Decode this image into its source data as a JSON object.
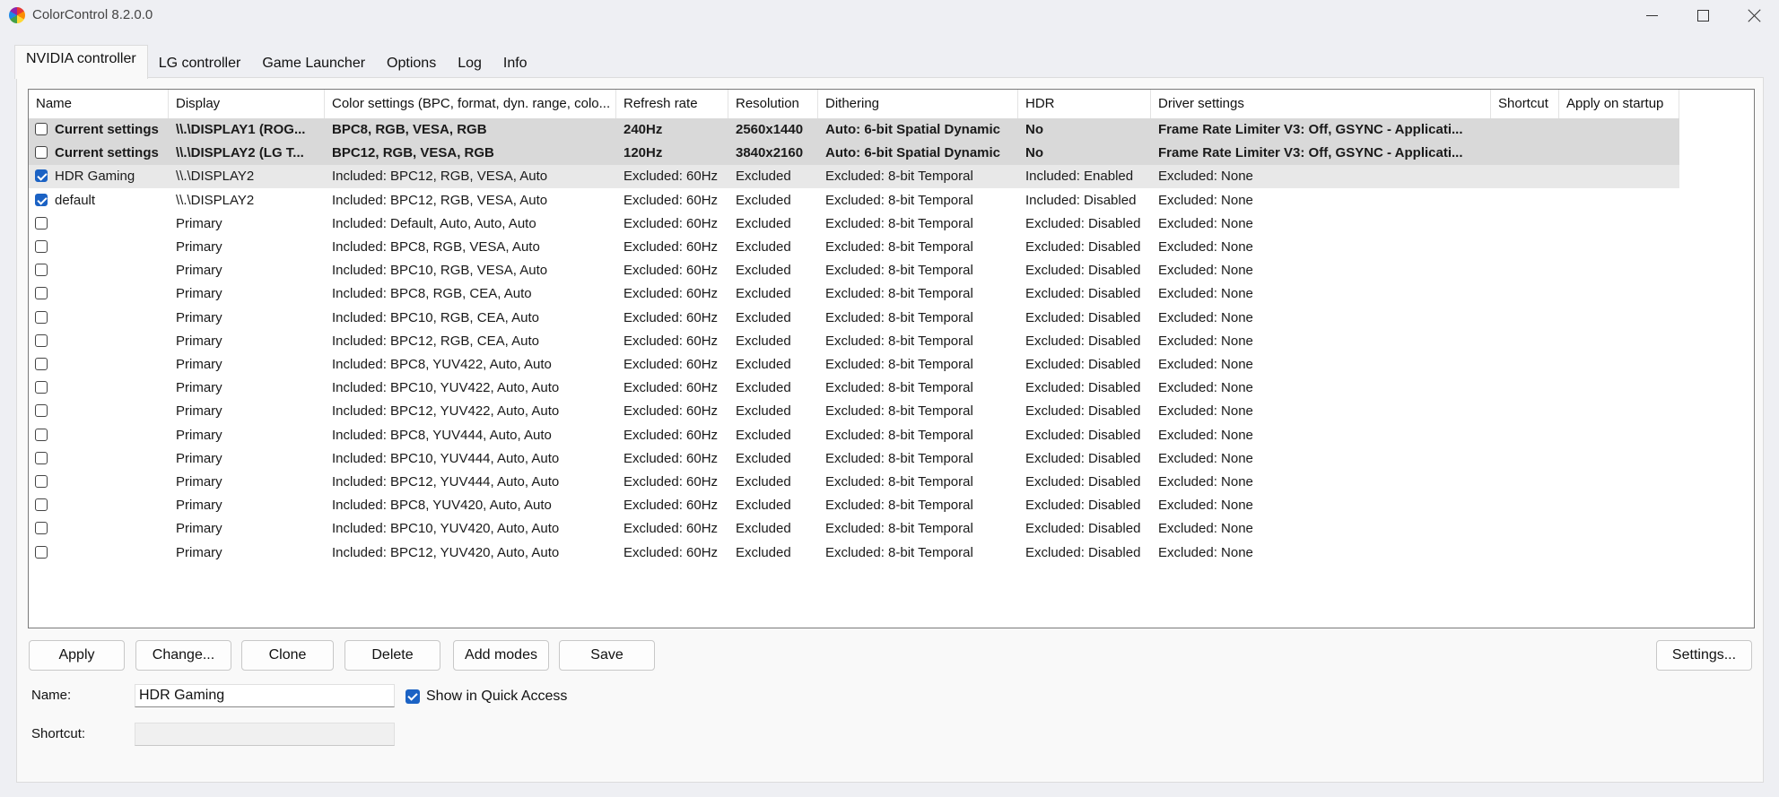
{
  "window": {
    "title": "ColorControl 8.2.0.0"
  },
  "tabs": [
    "NVIDIA controller",
    "LG controller",
    "Game Launcher",
    "Options",
    "Log",
    "Info"
  ],
  "grid": {
    "columns": [
      "Name",
      "Display",
      "Color settings (BPC, format, dyn. range, colo...",
      "Refresh rate",
      "Resolution",
      "Dithering",
      "HDR",
      "Driver settings",
      "Shortcut",
      "Apply on startup"
    ],
    "rows": [
      {
        "checked": false,
        "type": "current",
        "name": "Current settings",
        "display": "\\\\.\\DISPLAY1 (ROG...",
        "color": "BPC8, RGB, VESA, RGB",
        "refresh": "240Hz",
        "resolution": "2560x1440",
        "dithering": "Auto: 6-bit Spatial Dynamic",
        "hdr": "No",
        "driver": "Frame Rate Limiter V3: Off, GSYNC - Applicati..."
      },
      {
        "checked": false,
        "type": "current",
        "name": "Current settings",
        "display": "\\\\.\\DISPLAY2 (LG T...",
        "color": "BPC12, RGB, VESA, RGB",
        "refresh": "120Hz",
        "resolution": "3840x2160",
        "dithering": "Auto: 6-bit Spatial Dynamic",
        "hdr": "No",
        "driver": "Frame Rate Limiter V3: Off, GSYNC - Applicati..."
      },
      {
        "checked": true,
        "type": "selected",
        "name": "HDR Gaming",
        "display": "\\\\.\\DISPLAY2",
        "color": "Included: BPC12, RGB, VESA, Auto",
        "refresh": "Excluded: 60Hz",
        "resolution": "Excluded",
        "dithering": "Excluded: 8-bit Temporal",
        "hdr": "Included: Enabled",
        "driver": "Excluded: None"
      },
      {
        "checked": true,
        "type": "normal",
        "name": "default",
        "display": "\\\\.\\DISPLAY2",
        "color": "Included: BPC12, RGB, VESA, Auto",
        "refresh": "Excluded: 60Hz",
        "resolution": "Excluded",
        "dithering": "Excluded: 8-bit Temporal",
        "hdr": "Included: Disabled",
        "driver": "Excluded: None"
      },
      {
        "checked": false,
        "type": "normal",
        "name": "",
        "display": "Primary",
        "color": "Included: Default, Auto, Auto, Auto",
        "refresh": "Excluded: 60Hz",
        "resolution": "Excluded",
        "dithering": "Excluded: 8-bit Temporal",
        "hdr": "Excluded: Disabled",
        "driver": "Excluded: None"
      },
      {
        "checked": false,
        "type": "normal",
        "name": "",
        "display": "Primary",
        "color": "Included: BPC8, RGB, VESA, Auto",
        "refresh": "Excluded: 60Hz",
        "resolution": "Excluded",
        "dithering": "Excluded: 8-bit Temporal",
        "hdr": "Excluded: Disabled",
        "driver": "Excluded: None"
      },
      {
        "checked": false,
        "type": "normal",
        "name": "",
        "display": "Primary",
        "color": "Included: BPC10, RGB, VESA, Auto",
        "refresh": "Excluded: 60Hz",
        "resolution": "Excluded",
        "dithering": "Excluded: 8-bit Temporal",
        "hdr": "Excluded: Disabled",
        "driver": "Excluded: None"
      },
      {
        "checked": false,
        "type": "normal",
        "name": "",
        "display": "Primary",
        "color": "Included: BPC8, RGB, CEA, Auto",
        "refresh": "Excluded: 60Hz",
        "resolution": "Excluded",
        "dithering": "Excluded: 8-bit Temporal",
        "hdr": "Excluded: Disabled",
        "driver": "Excluded: None"
      },
      {
        "checked": false,
        "type": "normal",
        "name": "",
        "display": "Primary",
        "color": "Included: BPC10, RGB, CEA, Auto",
        "refresh": "Excluded: 60Hz",
        "resolution": "Excluded",
        "dithering": "Excluded: 8-bit Temporal",
        "hdr": "Excluded: Disabled",
        "driver": "Excluded: None"
      },
      {
        "checked": false,
        "type": "normal",
        "name": "",
        "display": "Primary",
        "color": "Included: BPC12, RGB, CEA, Auto",
        "refresh": "Excluded: 60Hz",
        "resolution": "Excluded",
        "dithering": "Excluded: 8-bit Temporal",
        "hdr": "Excluded: Disabled",
        "driver": "Excluded: None"
      },
      {
        "checked": false,
        "type": "normal",
        "name": "",
        "display": "Primary",
        "color": "Included: BPC8, YUV422, Auto, Auto",
        "refresh": "Excluded: 60Hz",
        "resolution": "Excluded",
        "dithering": "Excluded: 8-bit Temporal",
        "hdr": "Excluded: Disabled",
        "driver": "Excluded: None"
      },
      {
        "checked": false,
        "type": "normal",
        "name": "",
        "display": "Primary",
        "color": "Included: BPC10, YUV422, Auto, Auto",
        "refresh": "Excluded: 60Hz",
        "resolution": "Excluded",
        "dithering": "Excluded: 8-bit Temporal",
        "hdr": "Excluded: Disabled",
        "driver": "Excluded: None"
      },
      {
        "checked": false,
        "type": "normal",
        "name": "",
        "display": "Primary",
        "color": "Included: BPC12, YUV422, Auto, Auto",
        "refresh": "Excluded: 60Hz",
        "resolution": "Excluded",
        "dithering": "Excluded: 8-bit Temporal",
        "hdr": "Excluded: Disabled",
        "driver": "Excluded: None"
      },
      {
        "checked": false,
        "type": "normal",
        "name": "",
        "display": "Primary",
        "color": "Included: BPC8, YUV444, Auto, Auto",
        "refresh": "Excluded: 60Hz",
        "resolution": "Excluded",
        "dithering": "Excluded: 8-bit Temporal",
        "hdr": "Excluded: Disabled",
        "driver": "Excluded: None"
      },
      {
        "checked": false,
        "type": "normal",
        "name": "",
        "display": "Primary",
        "color": "Included: BPC10, YUV444, Auto, Auto",
        "refresh": "Excluded: 60Hz",
        "resolution": "Excluded",
        "dithering": "Excluded: 8-bit Temporal",
        "hdr": "Excluded: Disabled",
        "driver": "Excluded: None"
      },
      {
        "checked": false,
        "type": "normal",
        "name": "",
        "display": "Primary",
        "color": "Included: BPC12, YUV444, Auto, Auto",
        "refresh": "Excluded: 60Hz",
        "resolution": "Excluded",
        "dithering": "Excluded: 8-bit Temporal",
        "hdr": "Excluded: Disabled",
        "driver": "Excluded: None"
      },
      {
        "checked": false,
        "type": "normal",
        "name": "",
        "display": "Primary",
        "color": "Included: BPC8, YUV420, Auto, Auto",
        "refresh": "Excluded: 60Hz",
        "resolution": "Excluded",
        "dithering": "Excluded: 8-bit Temporal",
        "hdr": "Excluded: Disabled",
        "driver": "Excluded: None"
      },
      {
        "checked": false,
        "type": "normal",
        "name": "",
        "display": "Primary",
        "color": "Included: BPC10, YUV420, Auto, Auto",
        "refresh": "Excluded: 60Hz",
        "resolution": "Excluded",
        "dithering": "Excluded: 8-bit Temporal",
        "hdr": "Excluded: Disabled",
        "driver": "Excluded: None"
      },
      {
        "checked": false,
        "type": "normal",
        "name": "",
        "display": "Primary",
        "color": "Included: BPC12, YUV420, Auto, Auto",
        "refresh": "Excluded: 60Hz",
        "resolution": "Excluded",
        "dithering": "Excluded: 8-bit Temporal",
        "hdr": "Excluded: Disabled",
        "driver": "Excluded: None"
      }
    ]
  },
  "buttons": {
    "apply": "Apply",
    "change": "Change...",
    "clone": "Clone",
    "delete": "Delete",
    "add_modes": "Add modes",
    "save": "Save",
    "settings": "Settings..."
  },
  "form": {
    "name_label": "Name:",
    "name_value": "HDR Gaming",
    "quick_access_label": "Show in Quick Access",
    "quick_access_checked": true,
    "shortcut_label": "Shortcut:",
    "shortcut_value": ""
  },
  "colors": {
    "accent": "#1b62c4",
    "current_row": "#d9d9d9",
    "selected_row": "#e8e8e8"
  }
}
